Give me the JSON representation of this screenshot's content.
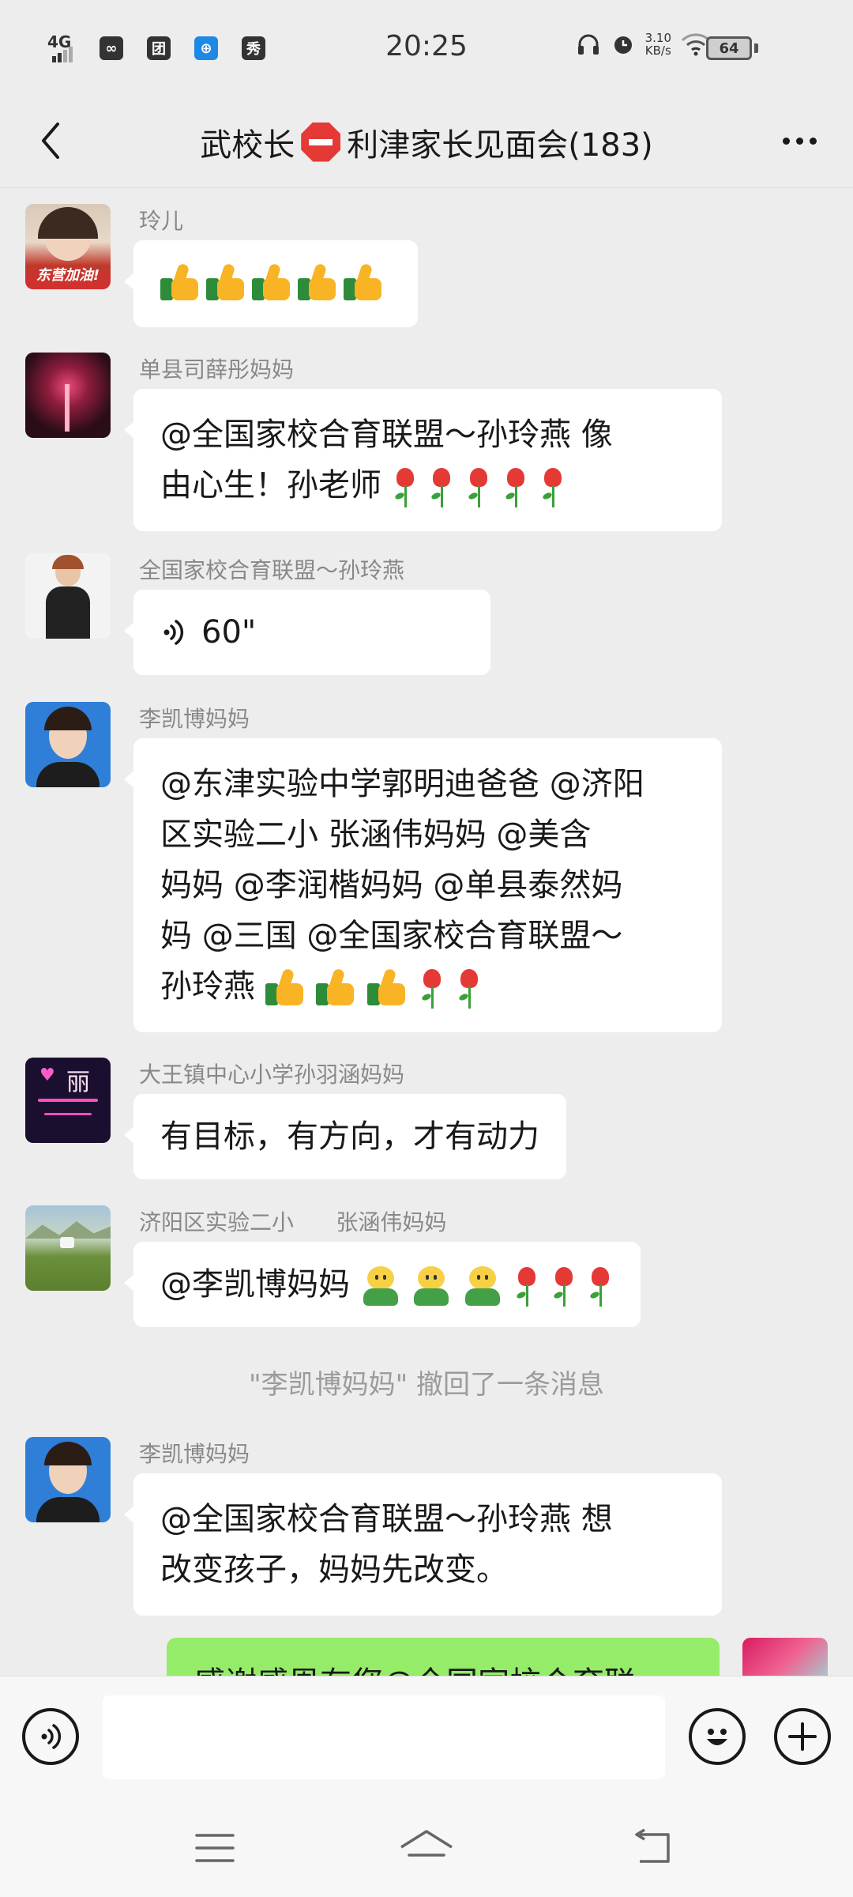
{
  "status_bar": {
    "network_label": "4G",
    "app_badges": [
      "∞",
      "团",
      "⊕",
      "秀"
    ],
    "time": "20:25",
    "net_speed_value": "3.10",
    "net_speed_unit": "KB/s",
    "battery": "64"
  },
  "header": {
    "title_prefix": "武校长",
    "title_suffix": "利津家长见面会(183)"
  },
  "messages": [
    {
      "sender": "玲儿",
      "avatar_label": "东营加油!"
    },
    {
      "sender": "单县司薛彤妈妈",
      "lines": [
        "@全国家校合育联盟～孙玲燕  像",
        "由心生！孙老师"
      ]
    },
    {
      "sender": "全国家校合育联盟～孙玲燕",
      "voice_duration": "60\""
    },
    {
      "sender": "李凯博妈妈",
      "lines": [
        "@东津实验中学郭明迪爸爸 @济阳",
        "区实验二小      张涵伟妈妈 @美含",
        "妈妈 @李润楷妈妈 @单县泰然妈",
        "妈 @三国 @全国家校合育联盟～",
        "孙玲燕"
      ]
    },
    {
      "sender": "大王镇中心小学孙羽涵妈妈",
      "text": "有目标，有方向，才有动力",
      "avatar_label": "丽"
    },
    {
      "sender": "济阳区实验二小      张涵伟妈妈",
      "text": "@李凯博妈妈"
    },
    {
      "sender": "李凯博妈妈",
      "lines": [
        "@全国家校合育联盟～孙玲燕   想",
        "改变孩子，妈妈先改变。"
      ]
    }
  ],
  "system_message": "\"李凯博妈妈\" 撤回了一条消息",
  "self_message": "感谢感恩有您@全国家校合育联",
  "input": {
    "placeholder": ""
  }
}
